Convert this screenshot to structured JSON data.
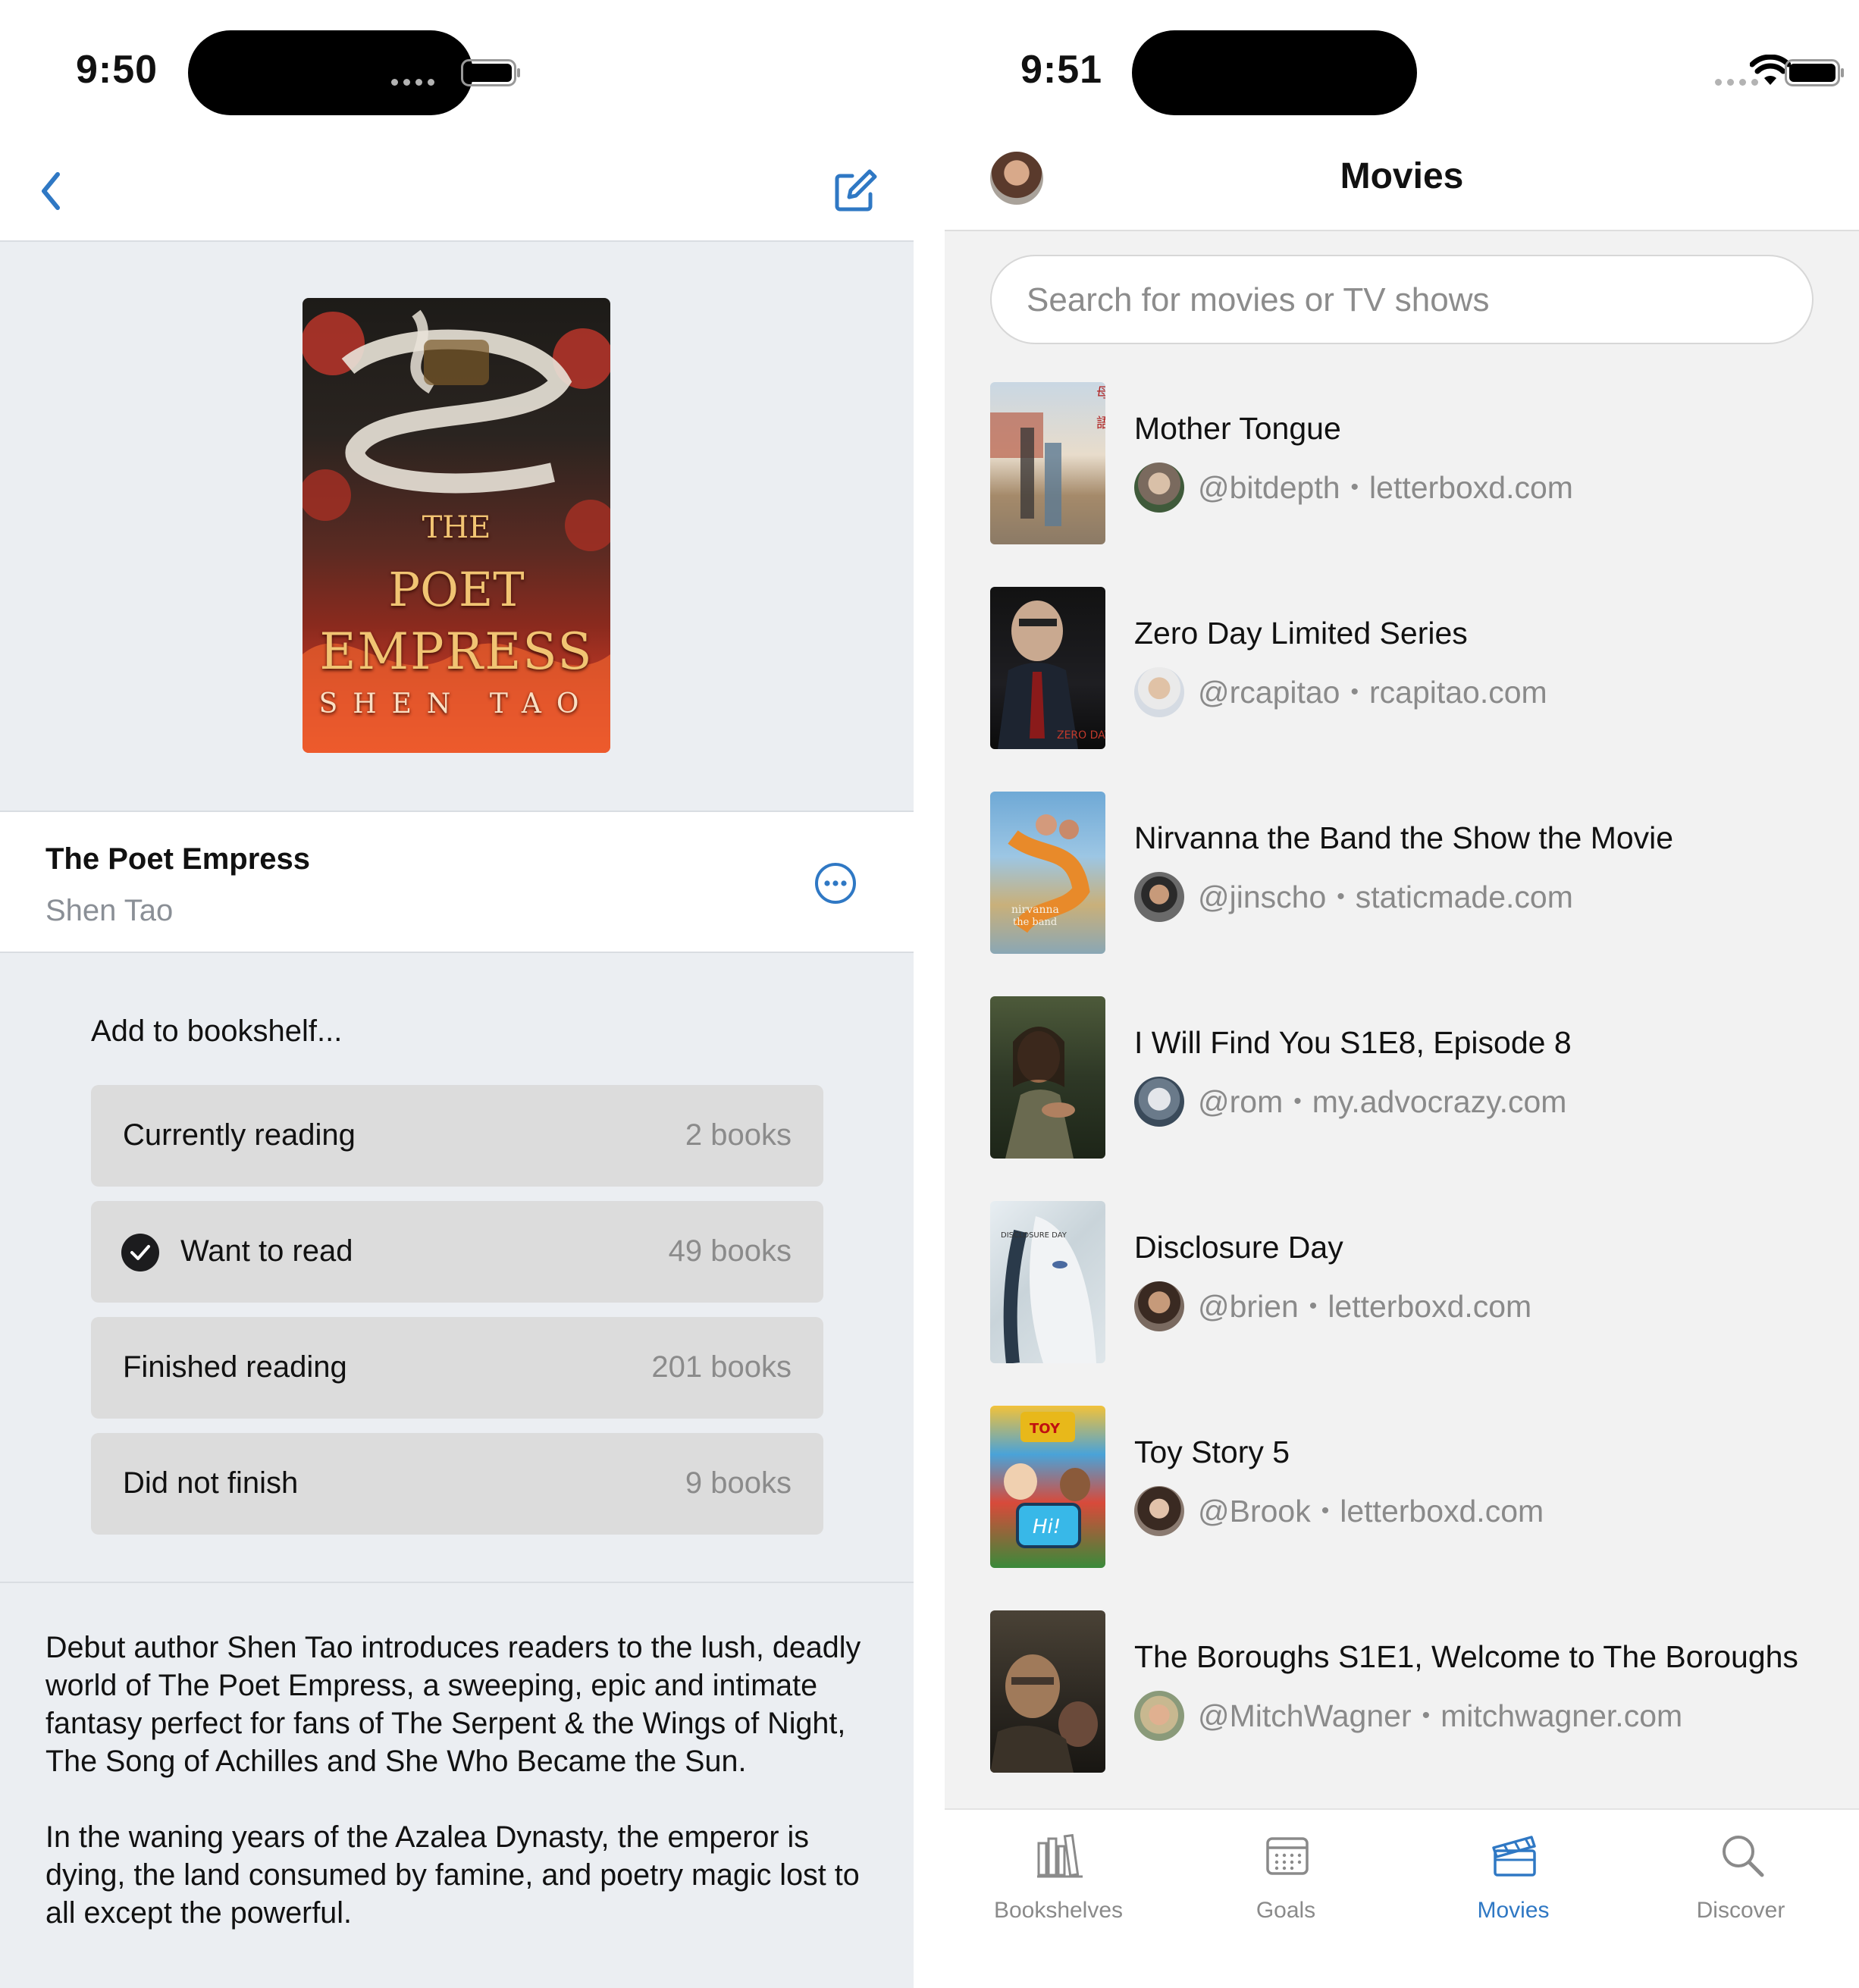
{
  "left": {
    "status": {
      "time": "9:50"
    },
    "book": {
      "cover_lines": [
        "THE",
        "POET",
        "EMPRESS",
        "SHEN TAO"
      ],
      "title": "The Poet Empress",
      "author": "Shen Tao"
    },
    "bookshelf": {
      "heading": "Add to bookshelf...",
      "shelves": [
        {
          "label": "Currently reading",
          "count": "2 books",
          "checked": false
        },
        {
          "label": "Want to read",
          "count": "49 books",
          "checked": true
        },
        {
          "label": "Finished reading",
          "count": "201 books",
          "checked": false
        },
        {
          "label": "Did not finish",
          "count": "9 books",
          "checked": false
        }
      ]
    },
    "description": [
      "Debut author Shen Tao introduces readers to the lush, deadly world of The Poet Empress, a sweeping, epic and intimate fantasy perfect for fans of The Serpent & the Wings of Night, The Song of Achilles and She Who Became the Sun.",
      "In the waning years of the Azalea Dynasty, the emperor is dying, the land consumed by famine, and poetry magic lost to all except the powerful."
    ],
    "icons": {
      "back": "chevron-left-icon",
      "edit": "compose-icon",
      "more": "ellipsis-circle-icon"
    }
  },
  "right": {
    "status": {
      "time": "9:51"
    },
    "title": "Movies",
    "search": {
      "placeholder": "Search for movies or TV shows",
      "value": ""
    },
    "movies": [
      {
        "title": "Mother Tongue",
        "handle": "@bitdepth",
        "site": "letterboxd.com"
      },
      {
        "title": "Zero Day Limited Series",
        "handle": "@rcapitao",
        "site": "rcapitao.com"
      },
      {
        "title": "Nirvanna the Band the Show the Movie",
        "handle": "@jinscho",
        "site": "staticmade.com"
      },
      {
        "title": "I Will Find You S1E8, Episode 8",
        "handle": "@rom",
        "site": "my.advocrazy.com"
      },
      {
        "title": "Disclosure Day",
        "handle": "@brien",
        "site": "letterboxd.com"
      },
      {
        "title": "Toy Story 5",
        "handle": "@Brook",
        "site": "letterboxd.com"
      },
      {
        "title": "The Boroughs S1E1, Welcome to The Boroughs",
        "handle": "@MitchWagner",
        "site": "mitchwagner.com"
      }
    ],
    "tabs": [
      {
        "label": "Bookshelves",
        "icon": "bookshelves-icon",
        "active": false
      },
      {
        "label": "Goals",
        "icon": "calendar-icon",
        "active": false
      },
      {
        "label": "Movies",
        "icon": "clapperboard-icon",
        "active": true
      },
      {
        "label": "Discover",
        "icon": "magnifier-icon",
        "active": false
      }
    ],
    "accent_color": "#2f78c4"
  }
}
